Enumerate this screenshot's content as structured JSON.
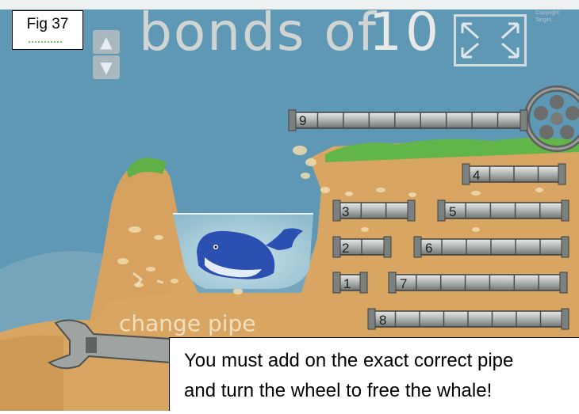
{
  "figure": {
    "label": "Fig 37"
  },
  "game": {
    "title_word": "bonds of",
    "title_number": "10",
    "up_arrow": "▲",
    "down_arrow": "▼",
    "change_pipe_label": "change pipe",
    "credit_line1": "Copyright",
    "credit_line2": "Target..."
  },
  "pipes": [
    {
      "label": "9",
      "length": 9
    },
    {
      "label": "4",
      "length": 4
    },
    {
      "label": "3",
      "length": 3
    },
    {
      "label": "5",
      "length": 5
    },
    {
      "label": "2",
      "length": 2
    },
    {
      "label": "6",
      "length": 6
    },
    {
      "label": "1",
      "length": 1
    },
    {
      "label": "7",
      "length": 7
    },
    {
      "label": "8",
      "length": 8
    }
  ],
  "caption": {
    "line1": "You must add on the exact correct pipe",
    "line2": "and turn the wheel to free the whale!"
  },
  "colors": {
    "sky": "#5e97b4",
    "sand": "#d9a461",
    "water": "#9fc7d6",
    "grass": "#6ab94a",
    "pipe": "#a7aaa8",
    "whale": "#2c4fb2"
  }
}
